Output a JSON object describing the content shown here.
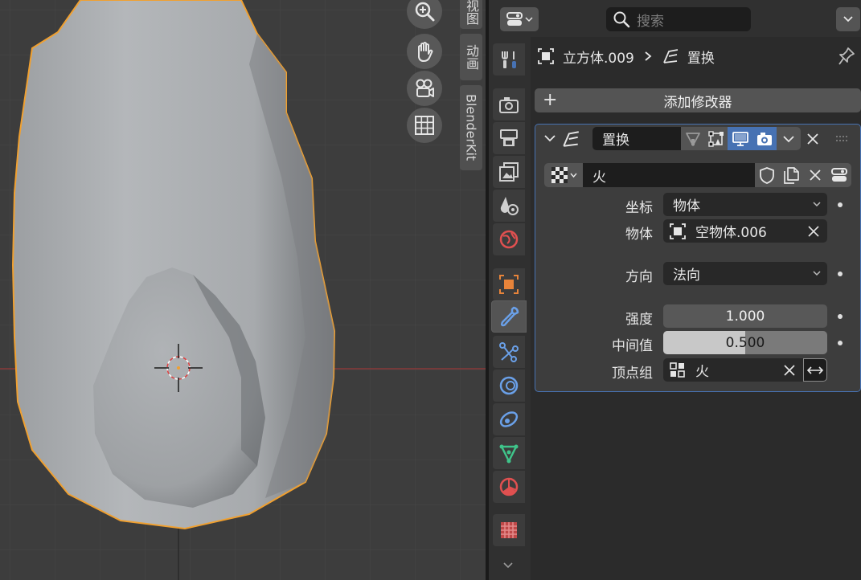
{
  "viewport": {
    "sidebar_tabs": [
      "视图",
      "动画",
      "BlenderKit"
    ]
  },
  "header": {
    "search_placeholder": "搜索"
  },
  "breadcrumb": {
    "object_name": "立方体.009",
    "modifier_name": "置换"
  },
  "add_modifier_label": "添加修改器",
  "modifier": {
    "name": "置换",
    "texture_name": "火",
    "fields": {
      "coords_label": "坐标",
      "coords_value": "物体",
      "object_label": "物体",
      "object_value": "空物体.006",
      "direction_label": "方向",
      "direction_value": "法向",
      "strength_label": "强度",
      "strength_value": "1.000",
      "midlevel_label": "中间值",
      "midlevel_value": "0.500",
      "midlevel_fraction": 0.5,
      "vgroup_label": "顶点组",
      "vgroup_value": "火"
    }
  },
  "colors": {
    "selection_outline": "#f0a030",
    "active_blue": "#4772b3",
    "viewport_bg": "#3d3d3d"
  }
}
